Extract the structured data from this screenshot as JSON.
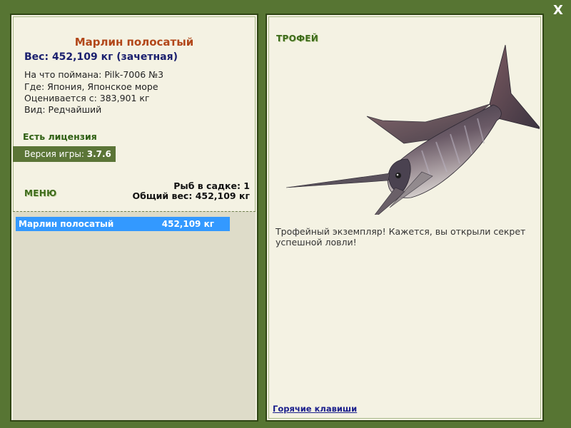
{
  "close_label": "X",
  "left": {
    "fish_name": "Марлин полосатый",
    "fish_weight": "Вес: 452,109 кг (зачетная)",
    "info": {
      "caught": "На что поймана: Pilk-7006 №3",
      "where": "Где: Япония, Японское море",
      "rated": "Оценивается с: 383,901 кг",
      "kind": "Вид: Редчайший"
    },
    "license": "Есть лицензия",
    "version_label": "Версия игры: ",
    "version_value": "3.7.6",
    "menu_label": "МЕНЮ",
    "cage_count": "Рыб в садке: 1",
    "total_weight": "Общий вес: 452,109 кг",
    "catch_list": [
      {
        "name": "Марлин полосатый",
        "weight": "452,109 кг"
      }
    ]
  },
  "right": {
    "trophy_label": "ТРОФЕЙ",
    "fish_image_icon": "marlin-fish-icon",
    "description": "Трофейный экземпляр! Кажется, вы открыли секрет успешной ловли!",
    "hotkeys": "Горячие клавиши"
  },
  "colors": {
    "background": "#577533",
    "panel": "#f4f2e3",
    "fish_name": "#b2471a",
    "weight": "#1a1f6e",
    "selected_row": "#3399ff"
  }
}
